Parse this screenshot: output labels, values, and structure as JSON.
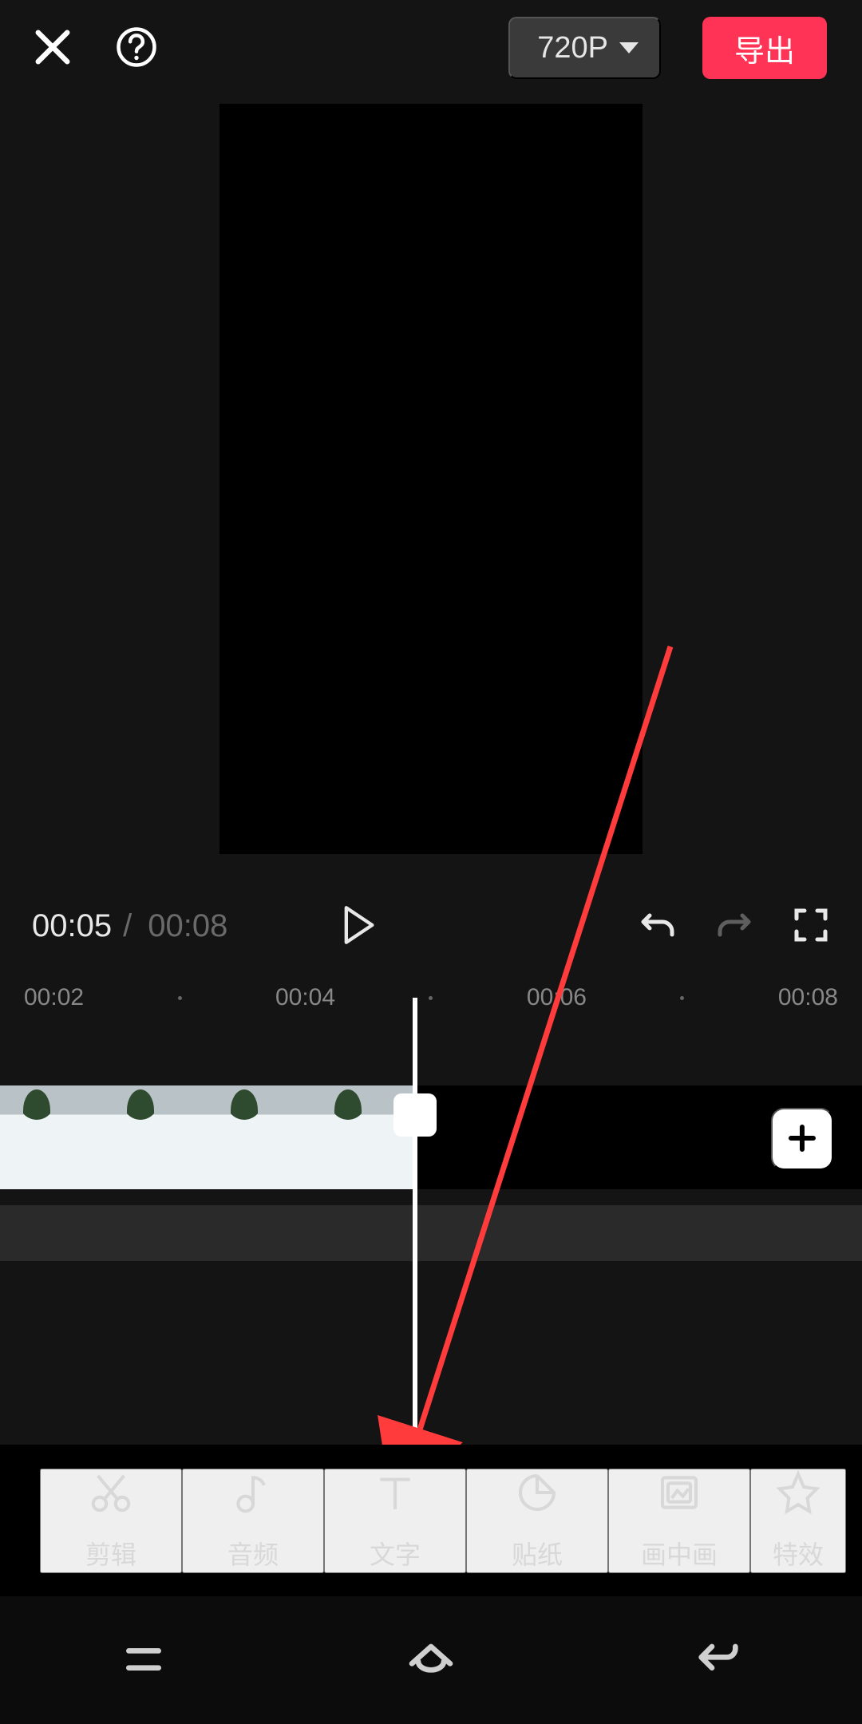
{
  "header": {
    "resolution_label": "720P",
    "export_label": "导出"
  },
  "player": {
    "current_time": "00:05",
    "separator": "/",
    "total_time": "00:08"
  },
  "ruler": {
    "ticks": [
      "00:02",
      "00:04",
      "00:06",
      "00:08"
    ]
  },
  "tools": [
    {
      "id": "edit",
      "label": "剪辑",
      "icon": "scissors-icon"
    },
    {
      "id": "audio",
      "label": "音频",
      "icon": "music-note-icon"
    },
    {
      "id": "text",
      "label": "文字",
      "icon": "text-t-icon"
    },
    {
      "id": "sticker",
      "label": "贴纸",
      "icon": "sticker-icon"
    },
    {
      "id": "pip",
      "label": "画中画",
      "icon": "pip-icon"
    },
    {
      "id": "effects",
      "label": "特效",
      "icon": "star-icon"
    }
  ],
  "add_clip_label": "+",
  "colors": {
    "accent": "#ff3355",
    "pill_bg": "#3a3a3a",
    "bg": "#141414"
  }
}
